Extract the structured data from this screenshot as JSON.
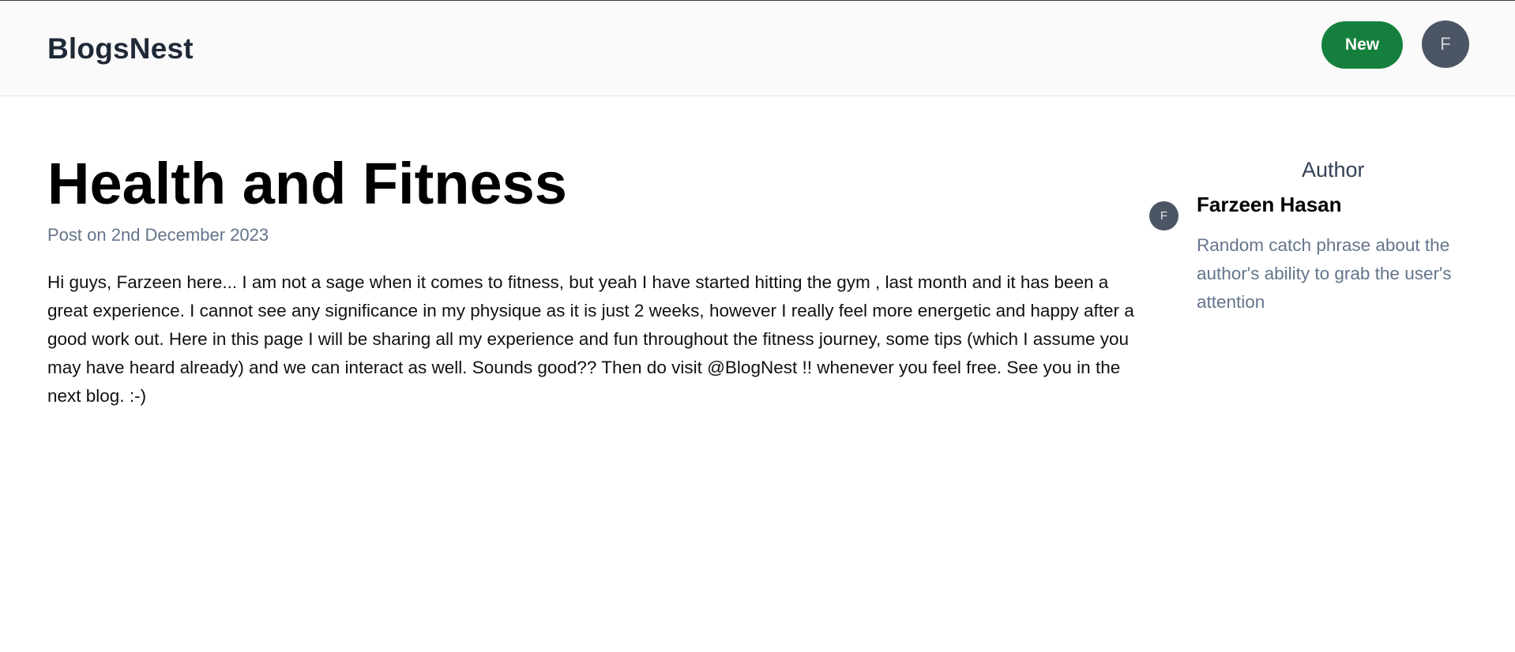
{
  "header": {
    "brand": "BlogsNest",
    "new_button_label": "New",
    "user_initial": "F"
  },
  "post": {
    "title": "Health and Fitness",
    "date_line": "Post on 2nd December 2023",
    "body": "Hi guys, Farzeen here... I am not a sage when it comes to fitness, but yeah I have started hitting the gym , last month and it has been a great experience. I cannot see any significance in my physique as it is just 2 weeks, however I really feel more energetic and happy after a good work out. Here in this page I will be sharing all my experience and fun throughout the fitness journey, some tips (which I assume you may have heard already) and we can interact as well. Sounds good?? Then do visit @BlogNest !! whenever you feel free. See you in the next blog. :-)"
  },
  "author": {
    "heading": "Author",
    "initial": "F",
    "name": "Farzeen Hasan",
    "bio": "Random catch phrase about the author's ability to grab the user's attention"
  },
  "colors": {
    "accent_green": "#15803d",
    "avatar_gray": "#4b5563",
    "muted_text": "#64748b"
  }
}
